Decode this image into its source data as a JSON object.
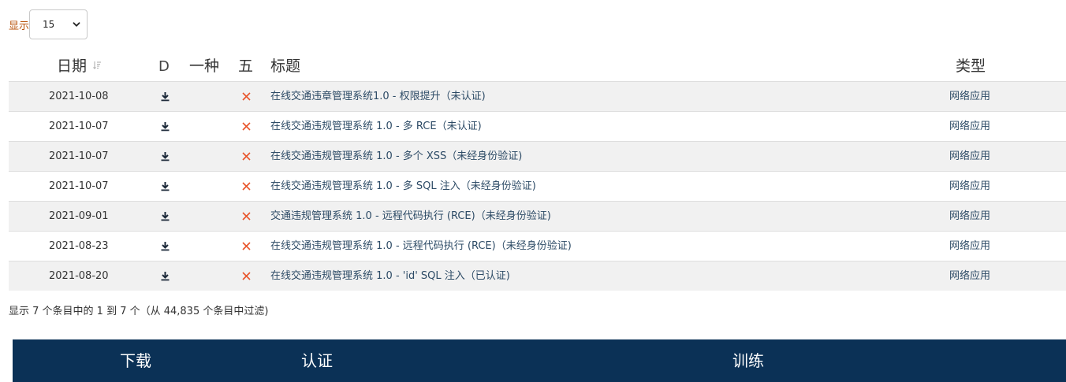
{
  "length_control": {
    "label": "显示",
    "selected": "15"
  },
  "table": {
    "headers": {
      "date": "日期",
      "download": "D",
      "col_yi": "一种",
      "col_wu": "五",
      "title": "标题",
      "type": "类型"
    },
    "rows": [
      {
        "date": "2021-10-08",
        "title": "在线交通违章管理系统1.0 - 权限提升（未认证)",
        "type": "网络应用"
      },
      {
        "date": "2021-10-07",
        "title": "在线交通违规管理系统 1.0 - 多 RCE（未认证)",
        "type": "网络应用"
      },
      {
        "date": "2021-10-07",
        "title": "在线交通违规管理系统 1.0 - 多个 XSS（未经身份验证)",
        "type": "网络应用"
      },
      {
        "date": "2021-10-07",
        "title": "在线交通违规管理系统 1.0 - 多 SQL 注入（未经身份验证)",
        "type": "网络应用"
      },
      {
        "date": "2021-09-01",
        "title": "交通违规管理系统 1.0 - 远程代码执行 (RCE)（未经身份验证)",
        "type": "网络应用"
      },
      {
        "date": "2021-08-23",
        "title": "在线交通违规管理系统 1.0 - 远程代码执行 (RCE)（未经身份验证)",
        "type": "网络应用"
      },
      {
        "date": "2021-08-20",
        "title": "在线交通违规管理系统 1.0 - 'id' SQL 注入（已认证)",
        "type": "网络应用"
      }
    ]
  },
  "info_text": "显示 7 个条目中的 1 到 7 个（从 44,835 个条目中过滤)",
  "bottom_nav": {
    "download": "下载",
    "certification": "认证",
    "training": "训练"
  },
  "colors": {
    "accent_label": "#b8520a",
    "link": "#2d4b66",
    "unverified_x": "#e8542a",
    "bottom_bar": "#0b3156"
  },
  "icons": {
    "sort": "sort-icon",
    "download": "download-icon",
    "unverified": "close-icon",
    "select": "chevron-down-icon"
  }
}
